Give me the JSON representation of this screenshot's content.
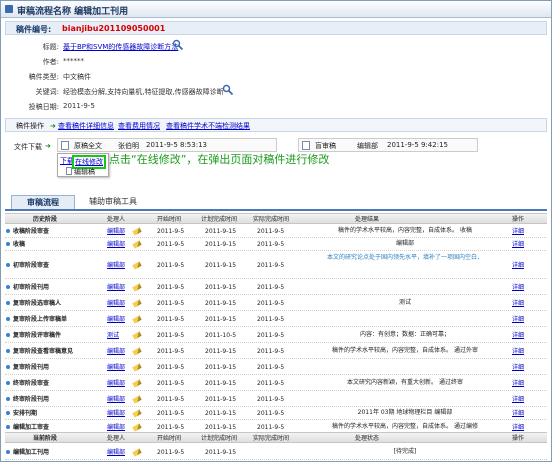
{
  "window": {
    "title": "审稿流程名称  编辑加工刊用"
  },
  "manuscript_no": {
    "label": "稿件编号:",
    "value": "bianjibu201109050001"
  },
  "fields": {
    "title_label": "标题:",
    "title_value": "基于BP和SVM的传感器故障诊断方法",
    "author_label": "作者:",
    "author_value": "******",
    "type_label": "稿件类型:",
    "type_value": "中文稿件",
    "keywords_label": "关键词:",
    "keywords_value": "经验模态分解,支持向量机,特征提取,传感器故障诊断",
    "date_label": "投稿日期:",
    "date_value": "2011-9-5"
  },
  "operations": {
    "label": "稿件操作",
    "links": [
      "查看稿件详细信息",
      "查看费用情况",
      "查看稿件学术不端检测结果"
    ]
  },
  "files": {
    "label": "文件下载",
    "file1": {
      "name": "原稿全文",
      "uploader": "张伯明",
      "time": "2011-9-5 8:53:13"
    },
    "file2": {
      "name": "盲审稿",
      "uploader": "编辑部",
      "time": "2011-9-5 9:42:15"
    },
    "download": "下载",
    "edit_online": "在线修改",
    "sub_item": "编辑稿",
    "annotation": "点击“在线修改”，在弹出页面对稿件进行修改"
  },
  "tabs": [
    "审稿流程",
    "辅助审稿工具"
  ],
  "history": {
    "headers": [
      "历史阶段",
      "处理人",
      "开始时间",
      "计划完成时间",
      "实际完成时间",
      "处理结果",
      "操作"
    ],
    "rows": [
      [
        "收稿阶段审查",
        "编辑部",
        "2011-9-5",
        "2011-9-15",
        "2011-9-5",
        "稿件的学术水平较高，内容完整，自成体系。 收稿",
        "详细"
      ],
      [
        "收稿",
        "编辑部",
        "2011-9-5",
        "2011-9-15",
        "2011-9-5",
        "编辑部",
        "详细"
      ],
      [
        "初审阶段审查",
        "编辑部",
        "2011-9-5",
        "2011-9-15",
        "2011-9-5",
        "本文的研究论点处于国内领先水平，填补了一项国内空白．",
        "详细"
      ],
      [
        "初审阶段刊用",
        "编辑部",
        "2011-9-5",
        "2011-9-15",
        "2011-9-5",
        "",
        "详细"
      ],
      [
        "复审阶段选审稿人",
        "编辑部",
        "2011-9-5",
        "2011-9-15",
        "2011-9-5",
        "测试",
        "详细"
      ],
      [
        "复审阶段上传审稿单",
        "编辑部",
        "2011-9-5",
        "2011-9-15",
        "2011-9-5",
        "",
        "详细"
      ],
      [
        "复审阶段评审稿件",
        "测试",
        "2011-9-5",
        "2011-10-5",
        "2011-9-5",
        "内容：有创意；数据：正确可靠；",
        "详细"
      ],
      [
        "复审阶段查看审稿意见",
        "编辑部",
        "2011-9-5",
        "2011-9-15",
        "2011-9-5",
        "稿件的学术水平较高，内容完整，自成体系。 通过外审",
        "详细"
      ],
      [
        "复审阶段刊用",
        "编辑部",
        "2011-9-5",
        "2011-9-15",
        "2011-9-5",
        "",
        "详细"
      ],
      [
        "终审阶段审查",
        "编辑部",
        "2011-9-5",
        "2011-9-15",
        "2011-9-5",
        "本文研究内容新颖，有重大创新。 通过终审",
        "详细"
      ],
      [
        "终审阶段刊用",
        "编辑部",
        "2011-9-5",
        "2011-9-15",
        "2011-9-5",
        "",
        "详细"
      ],
      [
        "安排刊期",
        "编辑部",
        "2011-9-5",
        "2011-9-15",
        "2011-9-5",
        "2011年 03期 地球物理栏目 编辑部",
        "详细"
      ],
      [
        "编辑加工审查",
        "编辑部",
        "2011-9-5",
        "2011-9-15",
        "2011-9-5",
        "稿件的学术水平较高，内容完整，自成体系。 通过编修",
        "详细"
      ]
    ]
  },
  "current": {
    "headers": [
      "当前阶段",
      "处理人",
      "开始时间",
      "计划完成时间",
      "实际完成时间",
      "处理状态",
      "操作"
    ],
    "rows": [
      [
        "编辑加工刊用",
        "编辑部",
        "2011-9-5",
        "2011-9-15",
        "",
        "[待完成]",
        ""
      ]
    ]
  }
}
